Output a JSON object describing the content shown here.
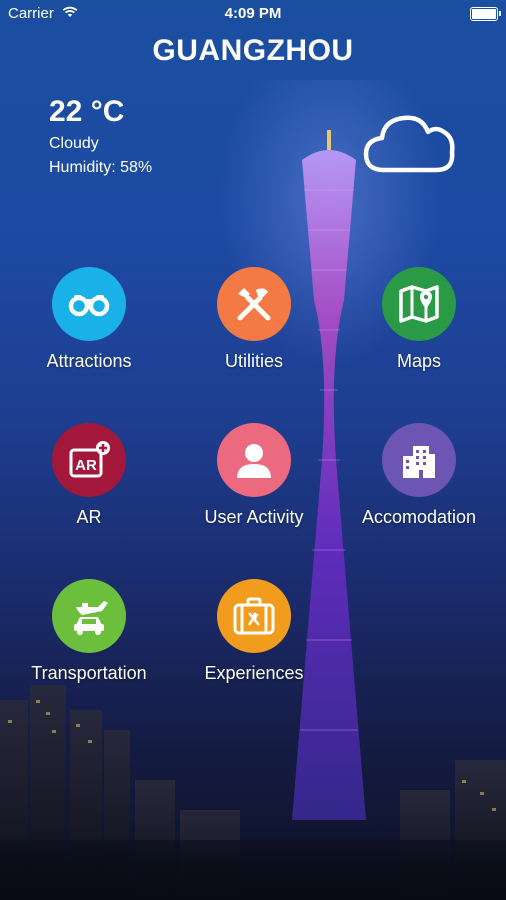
{
  "status_bar": {
    "carrier": "Carrier",
    "time": "4:09 PM"
  },
  "header": {
    "city": "GUANGZHOU"
  },
  "weather": {
    "temperature": "22 °C",
    "condition": "Cloudy",
    "humidity": "Humidity: 58%",
    "icon": "cloud-icon"
  },
  "menu": [
    {
      "label": "Attractions",
      "icon": "binoculars-icon",
      "color": "#1ab0e8"
    },
    {
      "label": "Utilities",
      "icon": "tools-icon",
      "color": "#f47a45"
    },
    {
      "label": "Maps",
      "icon": "map-pin-icon",
      "color": "#2a9a46"
    },
    {
      "label": "AR",
      "icon": "ar-icon",
      "color": "#a3173a"
    },
    {
      "label": "User Activity",
      "icon": "user-icon",
      "color": "#ec6a80"
    },
    {
      "label": "Accomodation",
      "icon": "building-icon",
      "color": "#6d55b4"
    },
    {
      "label": "Transportation",
      "icon": "transport-icon",
      "color": "#6cbf3c"
    },
    {
      "label": "Experiences",
      "icon": "luggage-icon",
      "color": "#f29c1d"
    }
  ]
}
